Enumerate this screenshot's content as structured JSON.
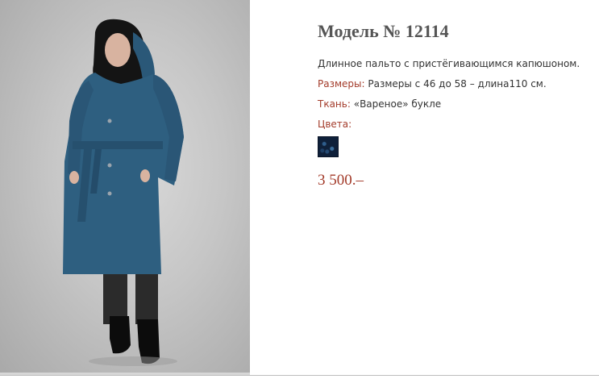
{
  "product": {
    "title": "Модель № 12114",
    "description": "Длинное пальто с пристёгивающимся капюшоном.",
    "sizes_label": "Размеры:",
    "sizes_value": " Размеры с 46 до 58 – длина110 см.",
    "fabric_label": "Ткань:",
    "fabric_value": " «Вареное» букле",
    "colors_label": "Цвета:",
    "price": "3 500.–"
  },
  "colors": {
    "accent": "#a33b2a",
    "coat": "#2e5f80",
    "swatch": "#0f203a"
  }
}
